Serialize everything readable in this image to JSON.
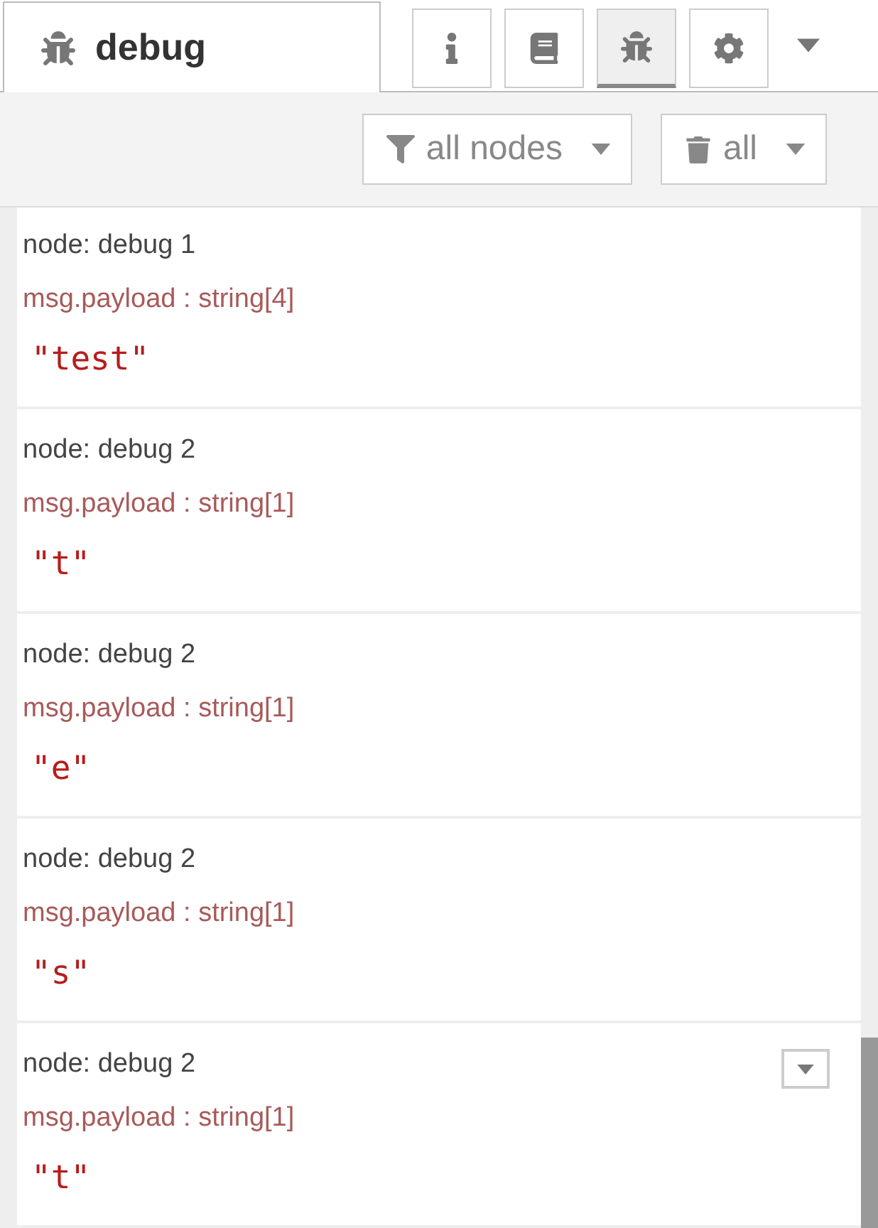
{
  "sidebar_tab": {
    "label": "debug"
  },
  "tab_buttons": [
    {
      "kind": "info",
      "selected": false
    },
    {
      "kind": "help",
      "selected": false
    },
    {
      "kind": "debug",
      "selected": true
    },
    {
      "kind": "config",
      "selected": false
    }
  ],
  "toolbar": {
    "filter": "all nodes",
    "clear": "all"
  },
  "messages": [
    {
      "node": "node: debug 1",
      "meta": "msg.payload : string[4]",
      "value": "\"test\"",
      "menu_button": false
    },
    {
      "node": "node: debug 2",
      "meta": "msg.payload : string[1]",
      "value": "\"t\"",
      "menu_button": false
    },
    {
      "node": "node: debug 2",
      "meta": "msg.payload : string[1]",
      "value": "\"e\"",
      "menu_button": false
    },
    {
      "node": "node: debug 2",
      "meta": "msg.payload : string[1]",
      "value": "\"s\"",
      "menu_button": false
    },
    {
      "node": "node: debug 2",
      "meta": "msg.payload : string[1]",
      "value": "\"t\"",
      "menu_button": true
    }
  ]
}
